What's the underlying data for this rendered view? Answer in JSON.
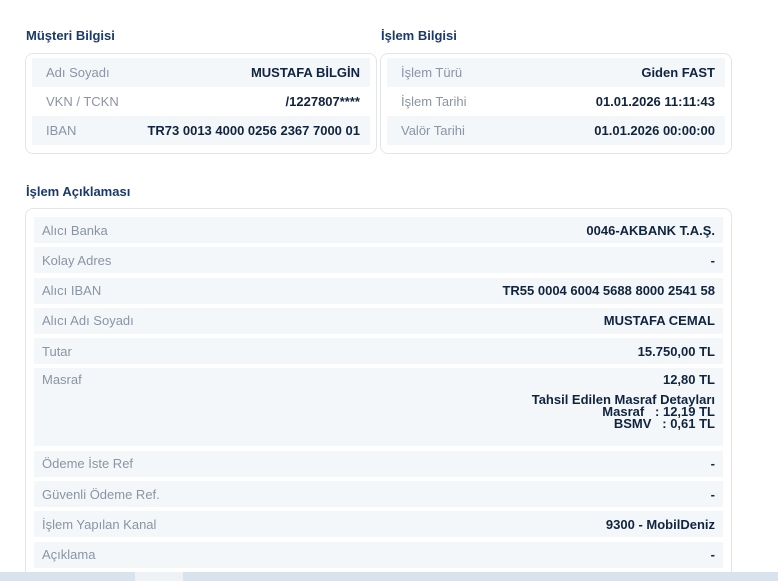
{
  "musteri": {
    "title": "Müşteri Bilgisi",
    "rows": [
      {
        "label": "Adı Soyadı",
        "value": "MUSTAFA BİLGİN"
      },
      {
        "label": "VKN / TCKN",
        "value": "/1227807****"
      },
      {
        "label": "IBAN",
        "value": "TR73 0013 4000 0256 2367 7000 01"
      }
    ]
  },
  "islem": {
    "title": "İşlem Bilgisi",
    "rows": [
      {
        "label": "İşlem Türü",
        "value": "Giden FAST"
      },
      {
        "label": "İşlem Tarihi",
        "value": "01.01.2026 11:11:43"
      },
      {
        "label": "Valör Tarihi",
        "value": "01.01.2026 00:00:00"
      }
    ]
  },
  "aciklama": {
    "title": "İşlem Açıklaması",
    "rows": [
      {
        "label": "Alıcı Banka",
        "value": "0046-AKBANK T.A.Ş."
      },
      {
        "label": "Kolay Adres",
        "value": "-"
      },
      {
        "label": "Alıcı IBAN",
        "value": "TR55 0004 6004 5688 8000 2541 58"
      },
      {
        "label": "Alıcı Adı Soyadı",
        "value": "MUSTAFA CEMAL"
      },
      {
        "label": "Tutar",
        "value": "15.750,00 TL"
      },
      {
        "label": "Masraf",
        "value": "12,80 TL"
      },
      {
        "label": "Ödeme İste Ref",
        "value": "-"
      },
      {
        "label": "Güvenli Ödeme Ref.",
        "value": "-"
      },
      {
        "label": "İşlem Yapılan Kanal",
        "value": "9300 - MobilDeniz"
      },
      {
        "label": "Açıklama",
        "value": "-"
      }
    ],
    "fee_details": {
      "title": "Tahsil Edilen Masraf Detayları",
      "masraf": "Masraf   : 12,19 TL",
      "bsmv": "BSMV   : 0,61 TL"
    }
  }
}
